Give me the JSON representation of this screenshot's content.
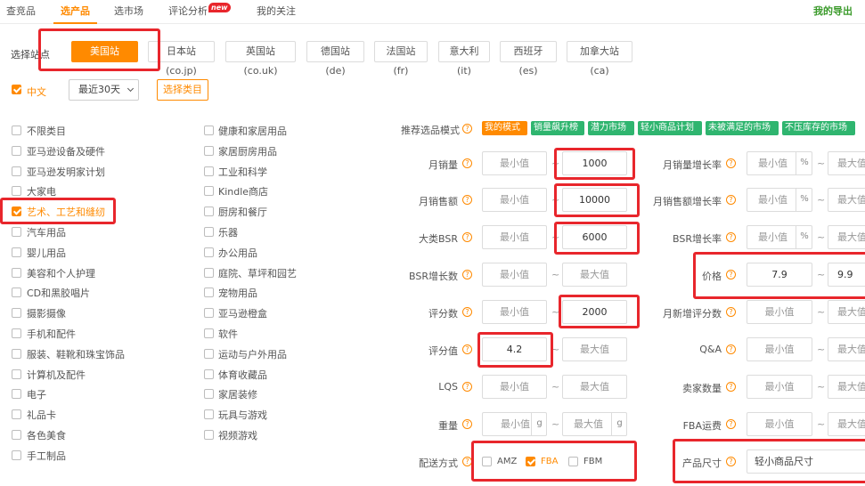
{
  "nav": {
    "tabs": [
      "查竞品",
      "选产品",
      "选市场",
      "评论分析",
      "我的关注"
    ],
    "new_badge": "new",
    "my_export": "我的导出"
  },
  "sites": {
    "label": "选择站点",
    "buttons": [
      "美国站(com)",
      "日本站(co.jp)",
      "英国站(co.uk)",
      "德国站(de)",
      "法国站(fr)",
      "意大利(it)",
      "西班牙(es)",
      "加拿大站(ca)"
    ]
  },
  "language": {
    "label": "中文",
    "checked": true
  },
  "period": {
    "selected": "最近30天"
  },
  "choose_category": "选择类目",
  "categories_left": [
    "不限类目",
    "亚马逊设备及硬件",
    "亚马逊发明家计划",
    "大家电",
    "艺术、工艺和缝纫",
    "汽车用品",
    "婴儿用品",
    "美容和个人护理",
    "CD和黑胶唱片",
    "摄影摄像",
    "手机和配件",
    "服装、鞋靴和珠宝饰品",
    "计算机及配件",
    "电子",
    "礼品卡",
    "各色美食",
    "手工制品"
  ],
  "categories_right": [
    "健康和家居用品",
    "家居厨房用品",
    "工业和科学",
    "Kindle商店",
    "厨房和餐厅",
    "乐器",
    "办公用品",
    "庭院、草坪和园艺",
    "宠物用品",
    "亚马逊橙盒",
    "软件",
    "运动与户外用品",
    "体育收藏品",
    "家居装修",
    "玩具与游戏",
    "视频游戏"
  ],
  "checked_category": "艺术、工艺和缝纫",
  "mode": {
    "label": "推荐选品模式",
    "tags": [
      "我的模式",
      "销量飙升榜",
      "潜力市场",
      "轻小商品计划",
      "未被满足的市场",
      "不压库存的市场"
    ]
  },
  "help_glyph": "?",
  "placeholders": {
    "min": "最小值",
    "max": "最大值",
    "max_short": "最大值"
  },
  "filters_left": {
    "monthly_sales": {
      "label": "月销量",
      "max": "1000"
    },
    "monthly_revenue": {
      "label": "月销售额",
      "max": "10000"
    },
    "bsr": {
      "label": "大类BSR",
      "max": "6000"
    },
    "bsr_growth_count": {
      "label": "BSR增长数"
    },
    "review_count": {
      "label": "评分数",
      "max": "2000"
    },
    "rating": {
      "label": "评分值",
      "min": "4.2"
    },
    "lqs": {
      "label": "LQS"
    },
    "weight": {
      "label": "重量",
      "unit": "g"
    },
    "shipping": {
      "label": "配送方式",
      "options": [
        "AMZ",
        "FBA",
        "FBM"
      ],
      "checked": "FBA"
    }
  },
  "filters_right": {
    "sales_growth": {
      "label": "月销量增长率",
      "unit": "%"
    },
    "revenue_growth": {
      "label": "月销售额增长率",
      "unit": "%"
    },
    "bsr_growth": {
      "label": "BSR增长率",
      "unit": "%"
    },
    "price": {
      "label": "价格",
      "min": "7.9",
      "max": "9.9"
    },
    "new_reviews": {
      "label": "月新增评分数"
    },
    "qa": {
      "label": "Q&A"
    },
    "sellers": {
      "label": "卖家数量"
    },
    "fba_fee": {
      "label": "FBA运费"
    },
    "size": {
      "label": "产品尺寸",
      "value": "轻小商品尺寸"
    }
  },
  "range_sep": "~",
  "colors": {
    "accent": "#ff8a00",
    "highlight": "#e8262c",
    "tag_green": "#2fb56f"
  }
}
